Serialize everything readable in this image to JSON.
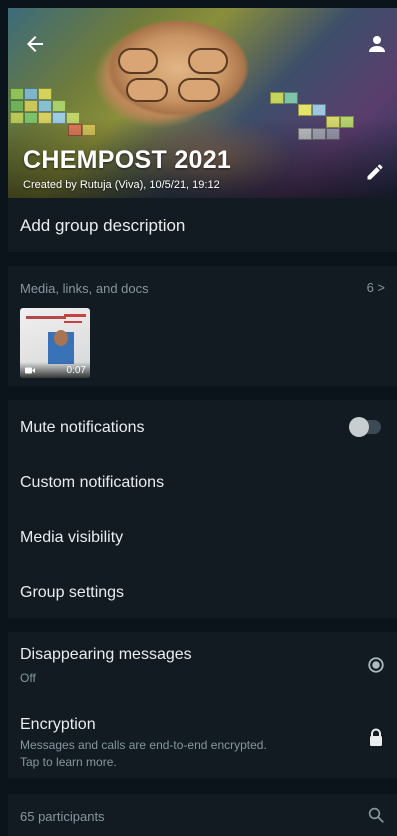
{
  "header": {
    "group_name": "CHEMPOST 2021",
    "created_by": "Created by Rutuja (Viva), 10/5/21, 19:12"
  },
  "description": {
    "label": "Add group description"
  },
  "media": {
    "title": "Media, links, and docs",
    "count": "6 >",
    "items": [
      {
        "type": "video",
        "duration": "0:07"
      }
    ]
  },
  "settings": {
    "mute_notifications": {
      "label": "Mute notifications",
      "enabled": false
    },
    "custom_notifications": {
      "label": "Custom notifications"
    },
    "media_visibility": {
      "label": "Media visibility"
    },
    "group_settings": {
      "label": "Group settings"
    }
  },
  "privacy": {
    "disappearing": {
      "label": "Disappearing messages",
      "value": "Off"
    },
    "encryption": {
      "label": "Encryption",
      "line1": "Messages and calls are end-to-end encrypted.",
      "line2": "Tap to learn more."
    }
  },
  "participants": {
    "label": "65 participants"
  },
  "colors": {
    "background": "#0b141a",
    "section": "#111b21",
    "primary_text": "#e9edef",
    "secondary_text": "#8696a0"
  }
}
